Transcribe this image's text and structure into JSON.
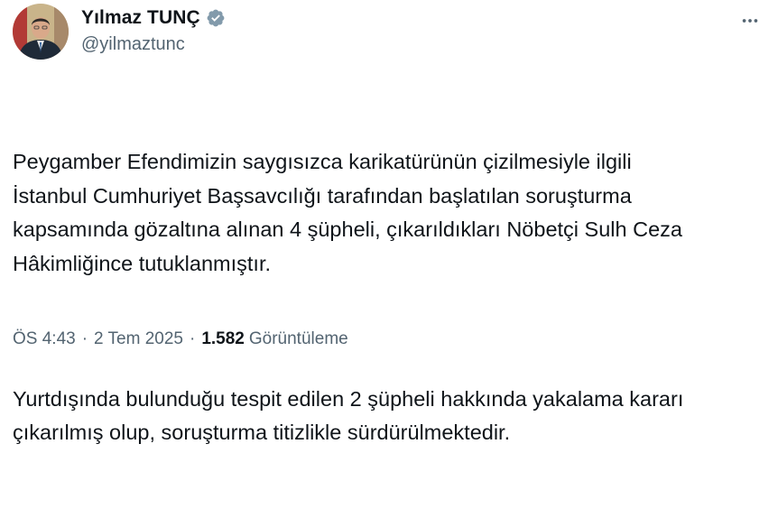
{
  "author": {
    "display_name": "Yılmaz TUNÇ",
    "handle": "@yilmaztunc",
    "verified_color": "#829aab"
  },
  "tweet": {
    "paragraphs": [
      "Peygamber Efendimizin saygısızca karikatürünün çizilmesiyle ilgili\nİstanbul Cumhuriyet Başsavcılığı tarafından başlatılan soruşturma\nkapsamında gözaltına alınan 4 şüpheli, çıkarıldıkları Nöbetçi Sulh Ceza\nHâkimliğince tutuklanmıştır.",
      "Yurtdışında bulunduğu tespit edilen 2 şüpheli hakkında yakalama kararı\nçıkarılmış olup, soruşturma titizlikle sürdürülmektedir."
    ],
    "time": "ÖS 4:43",
    "separator": "·",
    "date": "2 Tem 2025",
    "views_count": "1.582",
    "views_label": "Görüntüleme"
  },
  "icons": {
    "avatar": "profile-photo",
    "verified": "verified-badge-icon",
    "more": "more-options-icon"
  }
}
